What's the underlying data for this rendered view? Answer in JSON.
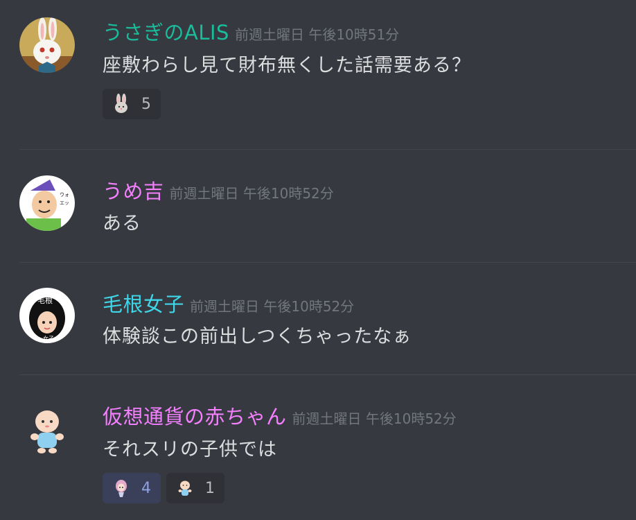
{
  "colors": {
    "background": "#36393f",
    "divider": "#42454a",
    "timestamp": "#72767d",
    "text": "#dcddde"
  },
  "messages": [
    {
      "username": "うさぎのALIS",
      "username_color": "#1abc9c",
      "timestamp": "前週土曜日 午後10時51分",
      "content": "座敷わらし見て財布無くした話需要ある？",
      "avatar_icon": "rabbit-avatar-icon",
      "reactions": [
        {
          "emoji_icon": "rabbit-face-icon",
          "count": "5"
        }
      ]
    },
    {
      "username": "うめ吉",
      "username_color": "#f47fff",
      "timestamp": "前週土曜日 午後10時52分",
      "content": "ある",
      "avatar_icon": "old-man-avatar-icon",
      "reactions": []
    },
    {
      "username": "毛根女子",
      "username_color": "#3ed6e8",
      "timestamp": "前週土曜日 午後10時52分",
      "content": "体験談この前出しつくちゃったなぁ",
      "avatar_icon": "hair-girl-avatar-icon",
      "reactions": []
    },
    {
      "username": "仮想通貨の赤ちゃん",
      "username_color": "#f47fff",
      "timestamp": "前週土曜日 午後10時52分",
      "content": "それスリの子供では",
      "avatar_icon": "baby-avatar-icon",
      "reactions": [
        {
          "emoji_icon": "pink-hair-girl-icon",
          "count": "4",
          "me": true
        },
        {
          "emoji_icon": "baby-icon",
          "count": "1"
        }
      ]
    }
  ]
}
